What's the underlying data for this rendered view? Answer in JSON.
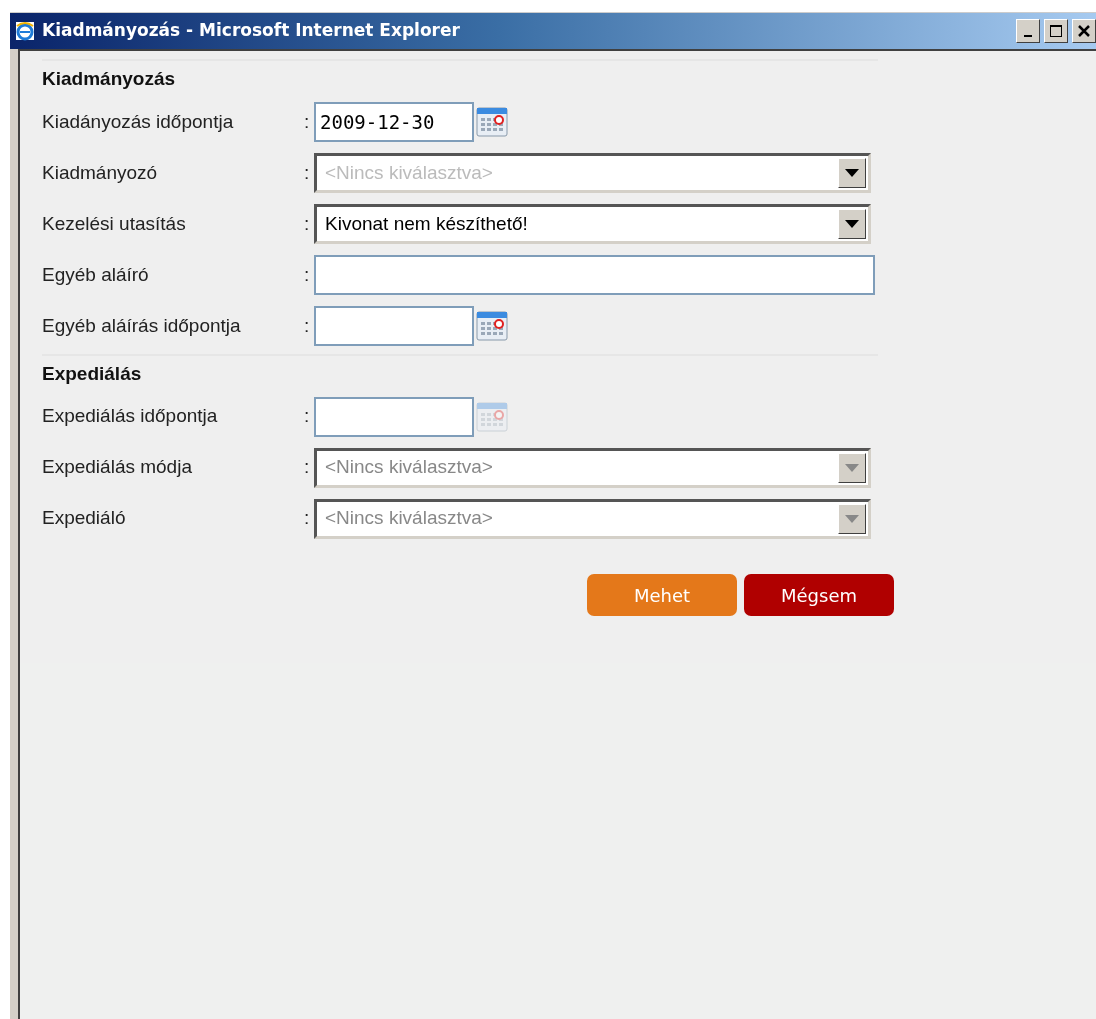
{
  "window": {
    "title": "Kiadmányozás - Microsoft Internet Explorer"
  },
  "sections": [
    {
      "title": "Kiadmányozás",
      "fields": [
        {
          "label": "Kiadányozás időpontja",
          "separator": ":",
          "kind": "date",
          "value": "2009-12-30",
          "disabled": false
        },
        {
          "label": "Kiadmányozó",
          "separator": ":",
          "kind": "select",
          "placeholder": "<Nincs kiválasztva>",
          "disabled": false
        },
        {
          "label": "Kezelési utasítás",
          "separator": ":",
          "kind": "select",
          "value": "Kivonat nem készíthető!",
          "disabled": false
        },
        {
          "label": "Egyéb aláíró",
          "separator": ":",
          "kind": "text",
          "disabled": false
        },
        {
          "label": "Egyéb aláírás időpontja",
          "separator": ":",
          "kind": "date",
          "disabled": false
        }
      ]
    },
    {
      "title": "Expediálás",
      "fields": [
        {
          "label": "Expediálás időpontja",
          "separator": ":",
          "kind": "date",
          "disabled": true
        },
        {
          "label": "Expediálás módja",
          "separator": ":",
          "kind": "select",
          "placeholder": "<Nincs kiválasztva>",
          "disabled": true
        },
        {
          "label": "Expediáló",
          "separator": ":",
          "kind": "select",
          "placeholder": "<Nincs kiválasztva>",
          "disabled": true
        }
      ]
    }
  ],
  "buttons": [
    {
      "label": "Mehet",
      "kind": "primary"
    },
    {
      "label": "Mégsem",
      "kind": "cancel"
    }
  ]
}
